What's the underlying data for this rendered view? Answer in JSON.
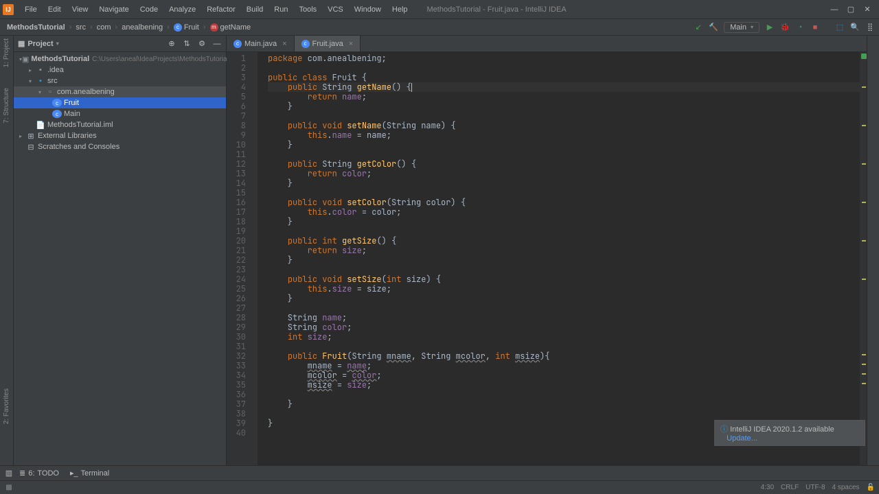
{
  "window": {
    "title": "MethodsTutorial - Fruit.java - IntelliJ IDEA"
  },
  "menubar": [
    "File",
    "Edit",
    "View",
    "Navigate",
    "Code",
    "Analyze",
    "Refactor",
    "Build",
    "Run",
    "Tools",
    "VCS",
    "Window",
    "Help"
  ],
  "breadcrumbs": {
    "project": "MethodsTutorial",
    "items": [
      "src",
      "com",
      "anealbening"
    ],
    "class": "Fruit",
    "method": "getName"
  },
  "runconfig": {
    "hammer": "⚙",
    "name": "Main"
  },
  "projectPanel": {
    "title": "Project",
    "rootName": "MethodsTutorial",
    "rootPath": "C:\\Users\\aneal\\IdeaProjects\\MethodsTutorial",
    "idea": ".idea",
    "src": "src",
    "pkg": "com.anealbening",
    "fruit": "Fruit",
    "main": "Main",
    "iml": "MethodsTutorial.iml",
    "external": "External Libraries",
    "scratches": "Scratches and Consoles"
  },
  "tabs": [
    {
      "label": "Main.java",
      "active": false
    },
    {
      "label": "Fruit.java",
      "active": true
    }
  ],
  "code": {
    "package": "com.anealbening",
    "className": "Fruit",
    "lines": 40
  },
  "notification": {
    "title": "IntelliJ IDEA 2020.1.2 available",
    "link": "Update..."
  },
  "bottomTabs": {
    "todo": "TODO",
    "terminal": "Terminal"
  },
  "status": {
    "pos": "4:30",
    "eol": "CRLF",
    "enc": "UTF-8",
    "indent": "4 spaces"
  },
  "sideLabels": {
    "project": "1: Project",
    "structure": "7: Structure",
    "favorites": "2: Favorites"
  }
}
